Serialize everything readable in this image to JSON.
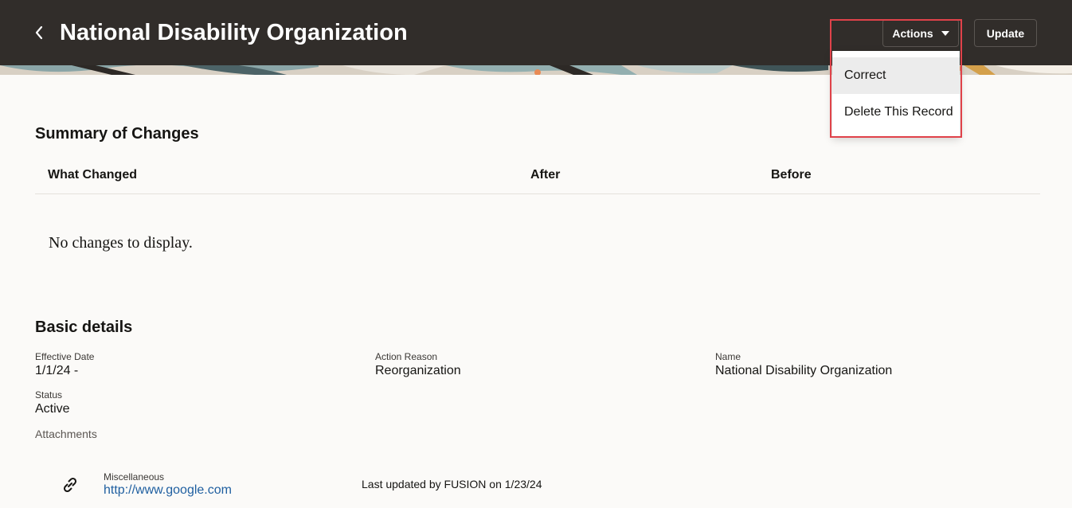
{
  "header": {
    "title": "National Disability Organization",
    "back_icon": "chevron-left-icon",
    "actions_label": "Actions",
    "actions_icon": "caret-down-icon",
    "update_label": "Update"
  },
  "actions_menu": {
    "items": [
      "Correct",
      "Delete This Record"
    ]
  },
  "summary": {
    "title": "Summary of Changes",
    "columns": [
      "What Changed",
      "After",
      "Before"
    ],
    "empty_message": "No changes to display."
  },
  "basic_details": {
    "title": "Basic details",
    "fields": [
      {
        "label": "Effective Date",
        "value": "1/1/24 -"
      },
      {
        "label": "Action Reason",
        "value": "Reorganization"
      },
      {
        "label": "Name",
        "value": "National Disability Organization"
      },
      {
        "label": "Status",
        "value": "Active"
      }
    ],
    "attachments_label": "Attachments",
    "attachment": {
      "icon": "link-icon",
      "category": "Miscellaneous",
      "url": "http://www.google.com",
      "last_updated": "Last updated by FUSION on 1/23/24"
    }
  },
  "colors": {
    "header_bg": "#312d2a",
    "page_bg": "#fbfaf8",
    "highlight": "#e0424a",
    "link": "#1f5fa0"
  }
}
